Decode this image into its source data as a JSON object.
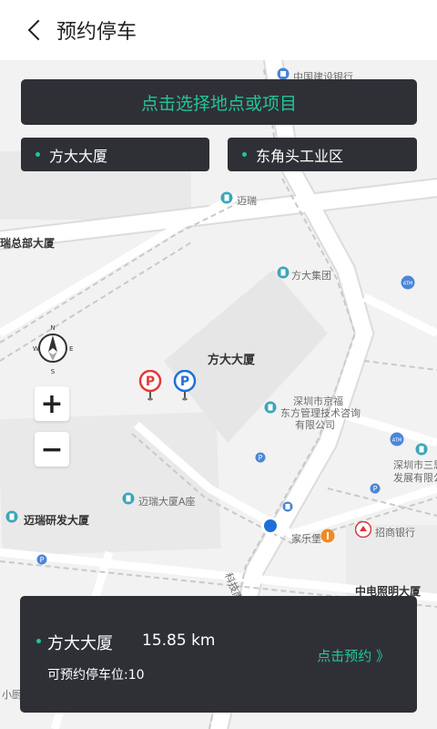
{
  "header": {
    "title": "预约停车"
  },
  "pick_button": {
    "label": "点击选择地点或项目"
  },
  "chips": [
    {
      "label": "方大大厦"
    },
    {
      "label": "东角头工业区"
    }
  ],
  "map_labels": {
    "bank_top": "中国建设银行",
    "maitui": "迈瑞",
    "ruizongbu": "瑞总部大厦",
    "fangda_group": "方大集团",
    "atm": "ATM",
    "fangda_tower": "方大大厦",
    "jingfu_line1": "深圳市京福",
    "jingfu_line2": "东方管理技术咨询",
    "jingfu_line3": "有限公司",
    "maitui_a": "迈瑞大厦A座",
    "maitui_rd": "迈瑞研发大厦",
    "jialebao": "家乐堡",
    "cmb": "招商银行",
    "sanxin_line1": "深圳市三思",
    "sanxin_line2": "发展有限公司",
    "road": "科技南十二路",
    "zhongdian": "中电照明大厦",
    "xiaomo": "小厨",
    "compass_n": "N",
    "compass_s": "S",
    "compass_w": "W",
    "compass_e": "E"
  },
  "map_controls": {
    "zoom_in": "+",
    "zoom_out": "−"
  },
  "card": {
    "name": "方大大厦",
    "distance": "15.85 km",
    "availability": "可预约停车位:10",
    "reserve_label": "点击预约 》"
  },
  "colors": {
    "accent": "#23c59a",
    "panel": "#2f3036",
    "red_pin": "#e53935",
    "blue_pin": "#1e6fd9"
  }
}
